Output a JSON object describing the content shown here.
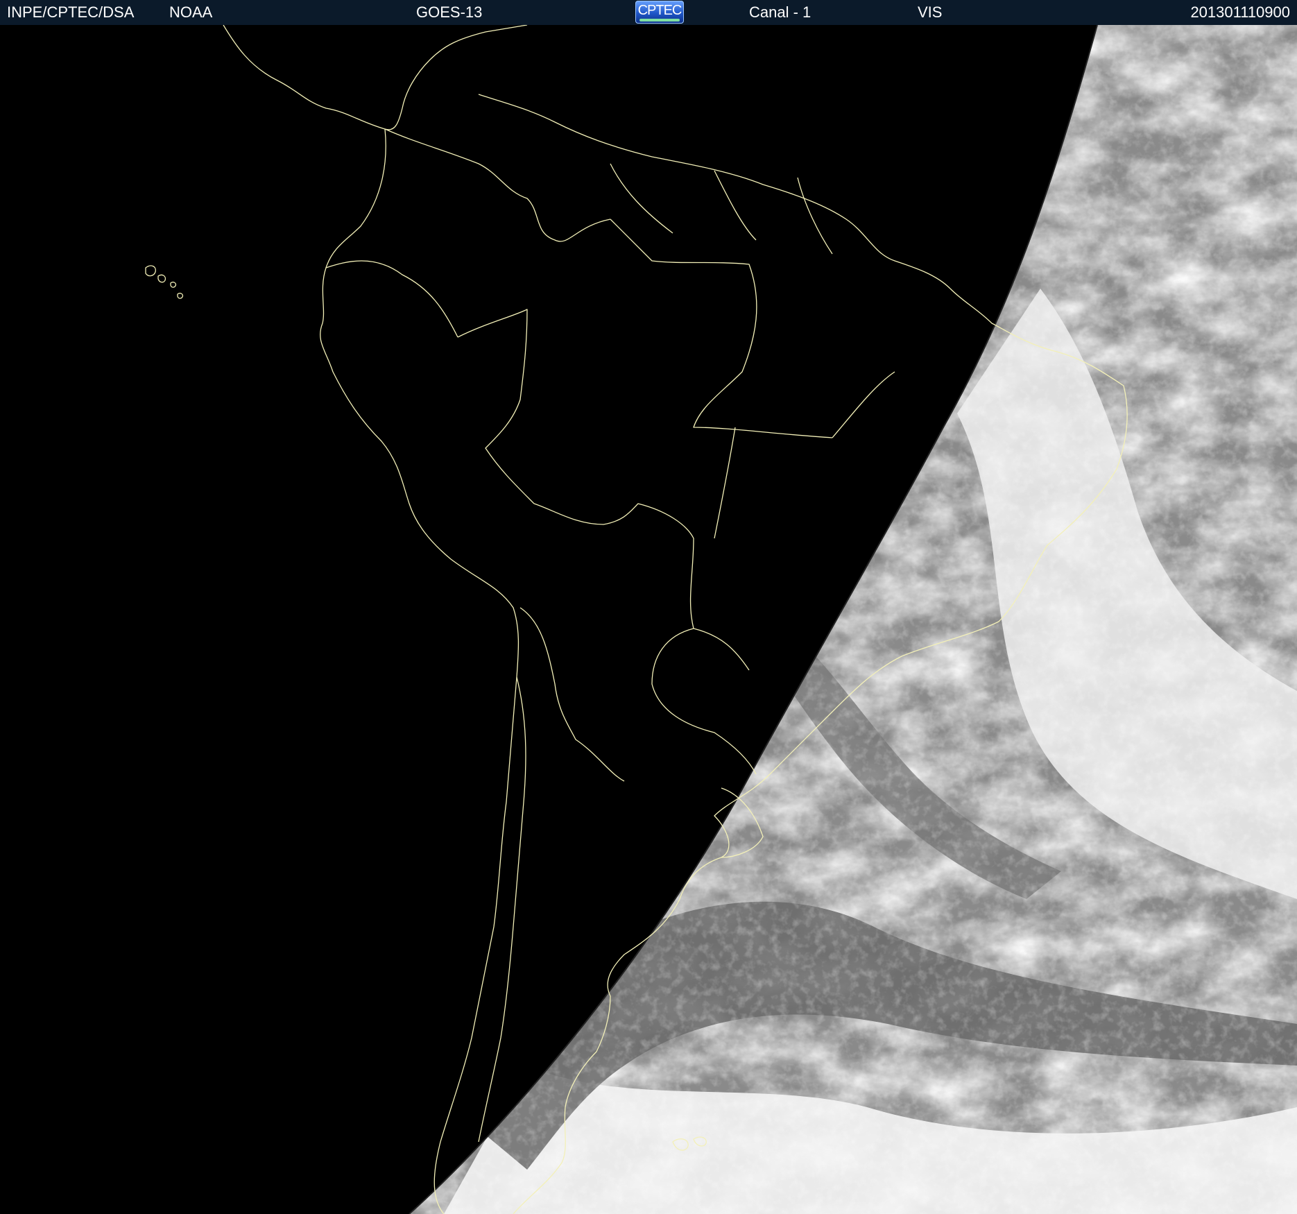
{
  "header": {
    "agency": "INPE/CPTEC/DSA",
    "source": "NOAA",
    "satellite": "GOES-13",
    "logo_text": "CPTEC",
    "channel": "Canal - 1",
    "band": "VIS",
    "timestamp": "201301110900"
  },
  "map": {
    "boundary_color": "#f3f0b8",
    "night_color": "#000000",
    "cloud_colors": [
      "#ffffff",
      "#e8e8e8",
      "#cfcfcf",
      "#a9a9a9",
      "#7d7d7d",
      "#5a5a5a"
    ]
  }
}
